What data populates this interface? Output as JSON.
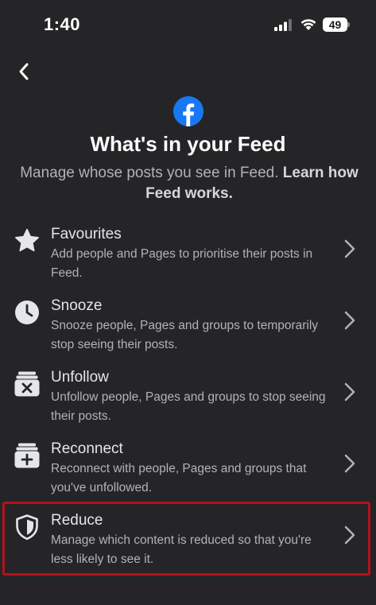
{
  "status_bar": {
    "time": "1:40",
    "battery": "49"
  },
  "header": {
    "title": "What's in your Feed",
    "subtitle": "Manage whose posts you see in Feed.",
    "learn_link": "Learn how Feed works."
  },
  "menu": [
    {
      "title": "Favourites",
      "description": "Add people and Pages to prioritise their posts in Feed.",
      "icon": "star-icon"
    },
    {
      "title": "Snooze",
      "description": "Snooze people, Pages and groups to temporarily stop seeing their posts.",
      "icon": "clock-icon"
    },
    {
      "title": "Unfollow",
      "description": "Unfollow people, Pages and groups to stop seeing their posts.",
      "icon": "unfollow-icon"
    },
    {
      "title": "Reconnect",
      "description": "Reconnect with people, Pages and groups that you've unfollowed.",
      "icon": "reconnect-icon"
    },
    {
      "title": "Reduce",
      "description": "Manage which content is reduced so that you're less likely to see it.",
      "icon": "shield-icon"
    }
  ],
  "colors": {
    "background": "#252527",
    "brand_blue": "#1877f2",
    "highlight": "#b3121b"
  }
}
